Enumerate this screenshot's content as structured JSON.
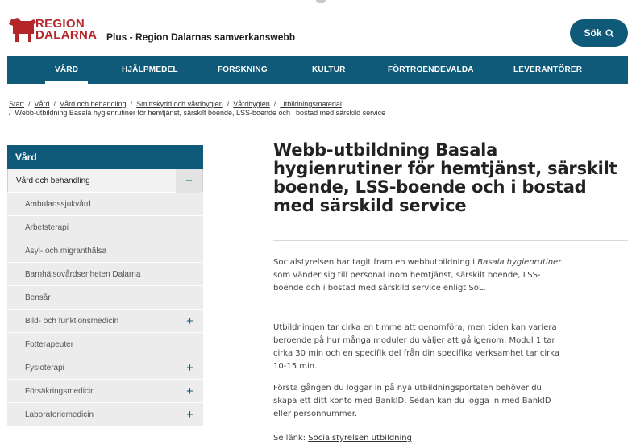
{
  "header": {
    "logo_line1": "REGION",
    "logo_line2": "DALARNA",
    "site_title": "Plus - Region Dalarnas samverkanswebb",
    "search_label": "Sök",
    "brand_color": "#0e5a78",
    "logo_color": "#b5262b"
  },
  "nav": {
    "items": [
      "VÅRD",
      "HJÄLPMEDEL",
      "FORSKNING",
      "KULTUR",
      "FÖRTROENDEVALDA",
      "LEVERANTÖRER"
    ],
    "active": "VÅRD"
  },
  "breadcrumb": {
    "items": [
      "Start",
      "Vård",
      "Vård och behandling",
      "Smittskydd och vårdhygien",
      "Vårdhygien",
      "Utbildningsmaterial"
    ],
    "current": "Webb-utbildning Basala hygienrutiner för hemtjänst, särskilt boende, LSS-boende och i bostad med särskild service"
  },
  "sidebar": {
    "heading": "Vård",
    "section": "Vård och behandling",
    "section_toggle": "−",
    "items": [
      {
        "label": "Ambulanssjukvård",
        "toggle": ""
      },
      {
        "label": "Arbetsterapi",
        "toggle": ""
      },
      {
        "label": "Asyl- och migranthälsa",
        "toggle": ""
      },
      {
        "label": "Barnhälsovårdsenheten Dalarna",
        "toggle": ""
      },
      {
        "label": "Bensår",
        "toggle": ""
      },
      {
        "label": "Bild- och funktionsmedicin",
        "toggle": "+"
      },
      {
        "label": "Fotterapeuter",
        "toggle": ""
      },
      {
        "label": "Fysioterapi",
        "toggle": "+"
      },
      {
        "label": "Försäkringsmedicin",
        "toggle": "+"
      },
      {
        "label": "Laboratoriemedicin",
        "toggle": "+"
      }
    ]
  },
  "article": {
    "title": "Webb-utbildning Basala hygienrutiner för hemtjänst, särskilt boende, LSS-boende och i bostad med särskild service",
    "p1_a": "Socialstyrelsen har tagit fram en webbutbildning i ",
    "p1_em": "Basala hygienrutiner",
    "p1_b": " som vänder sig till personal inom hemtjänst, särskilt boende, LSS-boende och i bostad med särskild service enligt SoL.",
    "p2": "Utbildningen tar cirka en timme att genomföra, men tiden kan variera beroende på hur många moduler du väljer att gå igenom. Modul 1 tar cirka 30 min och en specifik del från din specifika verksamhet tar cirka 10-15 min.",
    "p3": "Första gången du loggar in på nya utbildningsportalen behöver du skapa ett ditt konto med BankID. Sedan kan du logga in med BankID eller personnummer.",
    "link_prefix": "Se länk: ",
    "link_text": "Socialstyrelsen utbildning"
  }
}
